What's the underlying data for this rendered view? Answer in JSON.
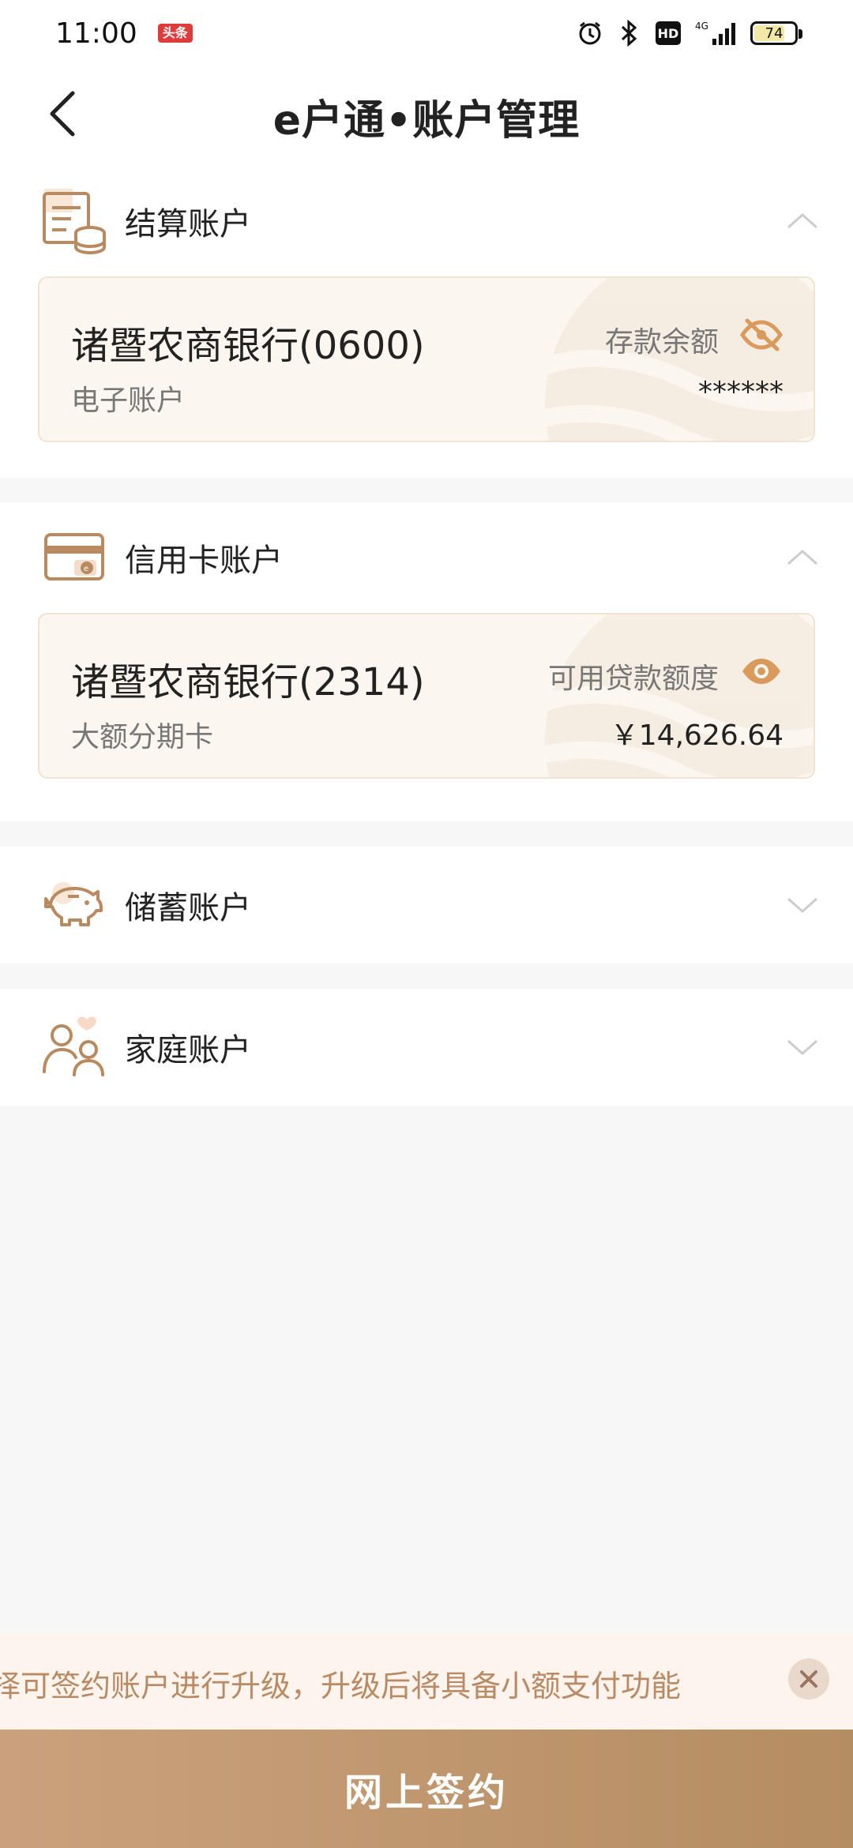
{
  "status_bar": {
    "time": "11:00",
    "badge": "头条",
    "hd": "HD",
    "network": "4G",
    "battery": "74"
  },
  "header": {
    "title": "e户通•账户管理"
  },
  "sections": [
    {
      "title": "结算账户",
      "expanded": true,
      "card": {
        "name": "诸暨农商银行(0600)",
        "type": "电子账户",
        "label": "存款余额",
        "value": "******",
        "eye": "eye-off-icon"
      }
    },
    {
      "title": "信用卡账户",
      "expanded": true,
      "card": {
        "name": "诸暨农商银行(2314)",
        "type": "大额分期卡",
        "label": "可用贷款额度",
        "value": "￥14,626.64",
        "eye": "eye-icon"
      }
    },
    {
      "title": "储蓄账户",
      "expanded": false
    },
    {
      "title": "家庭账户",
      "expanded": false
    }
  ],
  "notice": {
    "text": "择可签约账户进行升级，升级后将具备小额支付功能"
  },
  "footer": {
    "sign_label": "网上签约"
  },
  "colors": {
    "accent": "#b58d62",
    "icon": "#b98a5f",
    "notice_text": "#b98a64",
    "card_bg": "#fbf6ef"
  }
}
